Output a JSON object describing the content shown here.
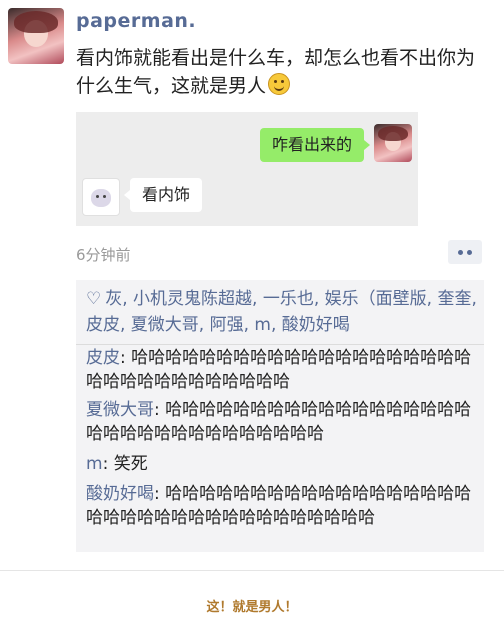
{
  "post": {
    "username": "paperman.",
    "text": "看内饰就能看出是什么车，却怎么也看不出你为什么生气，这就是男人",
    "emoji": "smiling-face-emoji",
    "timestamp": "6分钟前"
  },
  "chat_screenshot": {
    "right_message": "咋看出来的",
    "left_message": "看内饰"
  },
  "interactions": {
    "likes_text": "灰, 小机灵鬼陈超越, 一乐也, 娱乐（面壁版, 奎奎, 皮皮, 夏微大哥, 阿强, m, 酸奶好喝",
    "comments": [
      {
        "name": "皮皮",
        "text": "哈哈哈哈哈哈哈哈哈哈哈哈哈哈哈哈哈哈哈哈哈哈哈哈哈哈哈哈哈哈哈哈"
      },
      {
        "name": "夏微大哥",
        "text": "哈哈哈哈哈哈哈哈哈哈哈哈哈哈哈哈哈哈哈哈哈哈哈哈哈哈哈哈哈哈哈哈"
      },
      {
        "name": "m",
        "text": "笑死"
      },
      {
        "name": "酸奶好喝",
        "text": "哈哈哈哈哈哈哈哈哈哈哈哈哈哈哈哈哈哈哈哈哈哈哈哈哈哈哈哈哈哈哈哈哈哈哈"
      }
    ]
  },
  "caption": "这！就是男人！",
  "colors": {
    "link_blue": "#576b95",
    "bubble_green": "#95ec69",
    "caption_brown": "#b07a2e"
  }
}
